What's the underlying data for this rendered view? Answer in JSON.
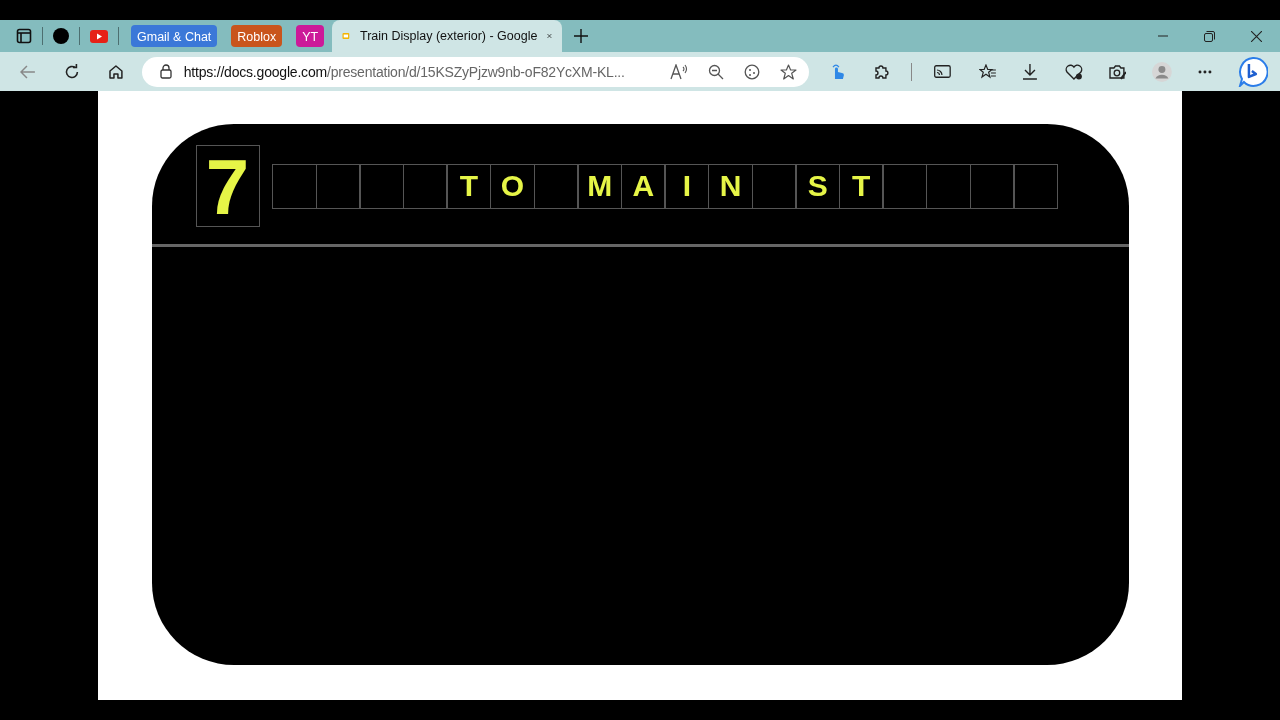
{
  "tab_groups": [
    {
      "label": "Gmail & Chat",
      "color": "#3b78d8"
    },
    {
      "label": "Roblox",
      "color": "#c9551c"
    },
    {
      "label": "YT",
      "color": "#cc1a99"
    }
  ],
  "tabs": [
    {
      "label": "Train Display (exterior) - Google",
      "selected": true
    }
  ],
  "address_bar": {
    "host": "https://docs.google.com",
    "path": "/presentation/d/15KSZyPjzw9nb-oF82YcXM-KL..."
  },
  "slide": {
    "route_number": "7",
    "destination_cells": [
      {
        "kind": "blank"
      },
      {
        "kind": "blank"
      },
      {
        "kind": "blank"
      },
      {
        "kind": "blank"
      },
      {
        "kind": "letter",
        "letter": "T"
      },
      {
        "kind": "letter",
        "letter": "O"
      },
      {
        "kind": "blank"
      },
      {
        "kind": "letter",
        "letter": "M"
      },
      {
        "kind": "letter",
        "letter": "A"
      },
      {
        "kind": "letter",
        "letter": "I"
      },
      {
        "kind": "letter",
        "letter": "N"
      },
      {
        "kind": "blank"
      },
      {
        "kind": "letter",
        "letter": "S"
      },
      {
        "kind": "letter",
        "letter": "T"
      },
      {
        "kind": "blank"
      },
      {
        "kind": "blank"
      },
      {
        "kind": "blank"
      },
      {
        "kind": "blank"
      }
    ]
  }
}
